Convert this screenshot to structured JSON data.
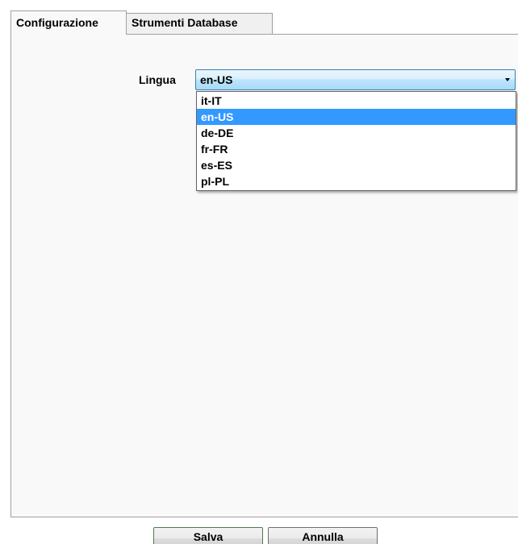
{
  "tabs": [
    {
      "label": "Configurazione",
      "active": true
    },
    {
      "label": "Strumenti Database",
      "active": false
    }
  ],
  "language": {
    "label": "Lingua",
    "selected": "en-US",
    "options": [
      "it-IT",
      "en-US",
      "de-DE",
      "fr-FR",
      "es-ES",
      "pl-PL"
    ],
    "dropdown_open": true
  },
  "buttons": {
    "save_label": "Salva",
    "cancel_label": "Annulla"
  },
  "colors": {
    "selection": "#3399ff",
    "combo_border": "#3c7fb1",
    "panel_background": "#f9f9f9"
  },
  "icons": {
    "combo_arrow": "chevron-down-icon"
  }
}
